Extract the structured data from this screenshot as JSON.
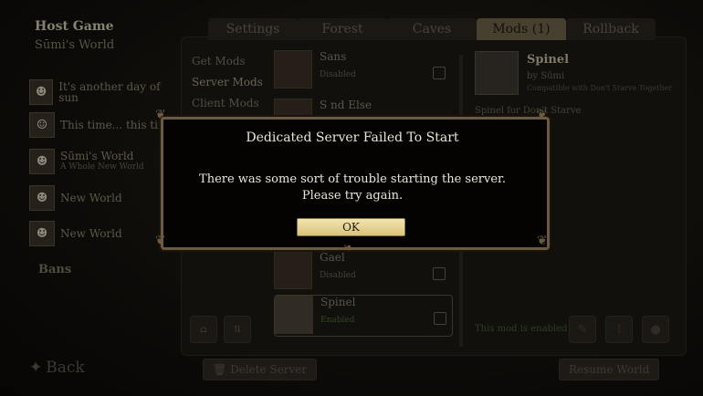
{
  "header": {
    "title": "Host Game",
    "world": "Sūmi's World"
  },
  "slots": [
    {
      "label": "It's another day of sun",
      "sub": ""
    },
    {
      "label": "This time... this tim",
      "sub": ""
    },
    {
      "label": "Sūmi's World",
      "sub": "A Whole New World"
    },
    {
      "label": "New World",
      "sub": ""
    },
    {
      "label": "New World",
      "sub": ""
    }
  ],
  "bans": "Bans",
  "back": "Back",
  "tabs": [
    "Settings",
    "Forest",
    "Caves",
    "Mods (1)",
    "Rollback"
  ],
  "menu": [
    "Get Mods",
    "Server Mods",
    "Client Mods"
  ],
  "mods": [
    {
      "name": "Sans",
      "status": "Disabled"
    },
    {
      "name": "S        nd Else",
      "status": ""
    },
    {
      "name": "  Gael",
      "status": "Disabled"
    },
    {
      "name": "Spinel",
      "status": "Enabled"
    }
  ],
  "detail": {
    "name": "Spinel",
    "by": "by Sūmi",
    "compat": "Compatible with Don't Starve Together",
    "desc": "Spinel for Don't Starve",
    "enabled": "This mod is enabled"
  },
  "buttons": {
    "delete": "Delete Server",
    "resume": "Resume World"
  },
  "dialog": {
    "title": "Dedicated Server Failed To Start",
    "body": "There was some sort of trouble starting the server. Please try again.",
    "ok": "OK"
  },
  "colors": {
    "accent": "#d9c37a",
    "frame": "#6b5a40",
    "enabled": "#406233"
  }
}
